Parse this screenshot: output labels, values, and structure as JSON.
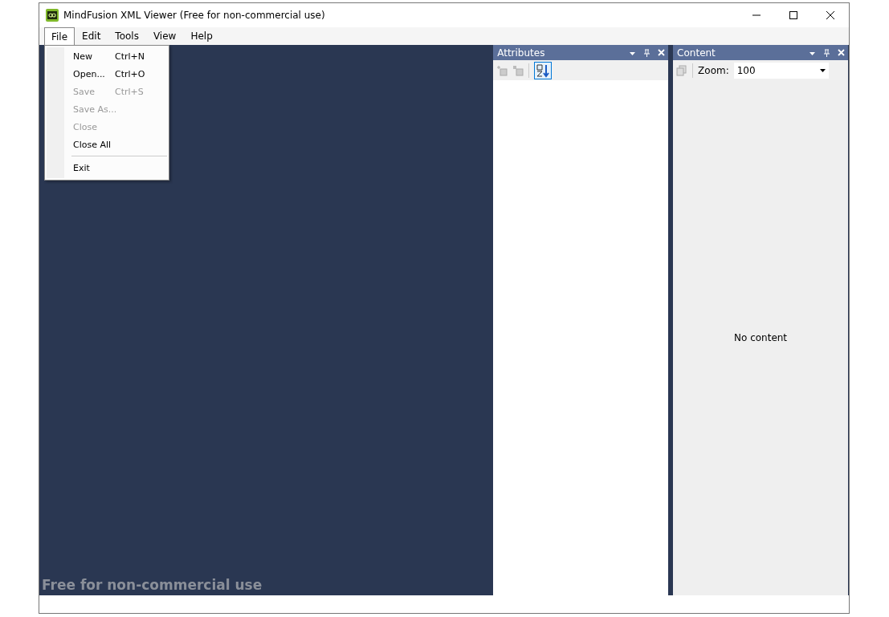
{
  "window": {
    "title": "MindFusion XML Viewer (Free for non-commercial use)"
  },
  "menu": [
    {
      "label": "File",
      "selected": true
    },
    {
      "label": "Edit",
      "selected": false
    },
    {
      "label": "Tools",
      "selected": false
    },
    {
      "label": "View",
      "selected": false
    },
    {
      "label": "Help",
      "selected": false
    }
  ],
  "file_menu": [
    {
      "kind": "item",
      "label": "New",
      "shortcut": "Ctrl+N",
      "disabled": false
    },
    {
      "kind": "item",
      "label": "Open...",
      "shortcut": "Ctrl+O",
      "disabled": false
    },
    {
      "kind": "item",
      "label": "Save",
      "shortcut": "Ctrl+S",
      "disabled": true
    },
    {
      "kind": "item",
      "label": "Save As...",
      "disabled": true
    },
    {
      "kind": "item",
      "label": "Close",
      "disabled": true
    },
    {
      "kind": "item",
      "label": "Close All",
      "disabled": false
    },
    {
      "kind": "separator"
    },
    {
      "kind": "item",
      "label": "Exit",
      "disabled": false
    }
  ],
  "workspace": {
    "banner": "Free for non-commercial use"
  },
  "attributes_panel": {
    "title": "Attributes"
  },
  "content_panel": {
    "title": "Content",
    "zoom_label": "Zoom:",
    "zoom_value": "100",
    "empty_text": "No content"
  }
}
